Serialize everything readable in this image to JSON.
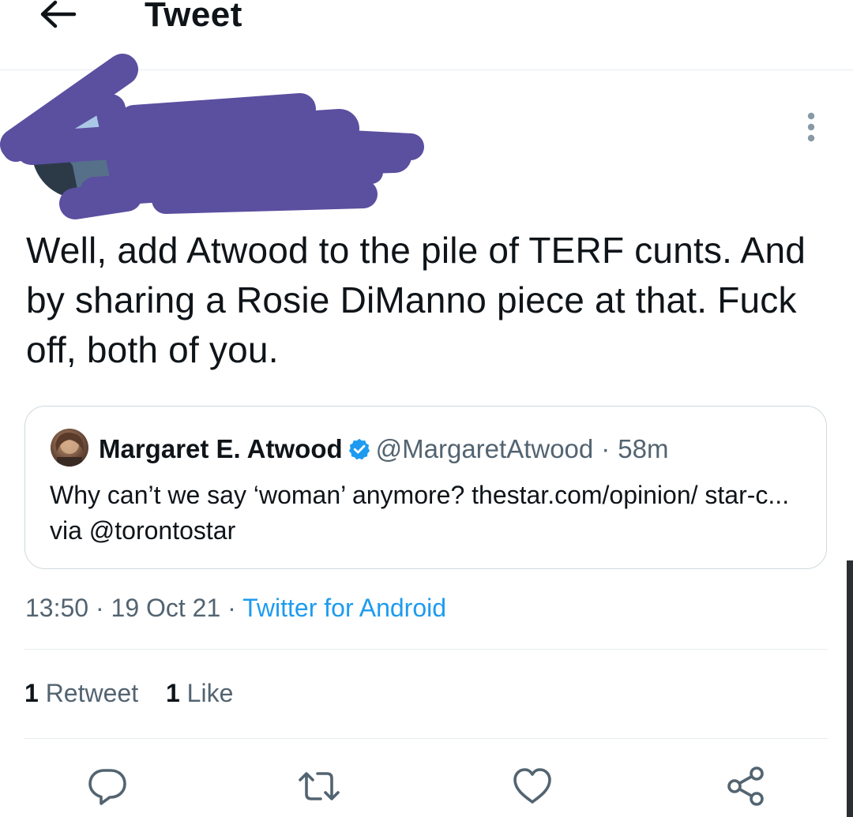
{
  "header": {
    "title": "Tweet"
  },
  "icons": {
    "back": "arrow-left-icon",
    "more": "more-vertical-icon",
    "verified": "verified-badge-icon",
    "reply": "reply-icon",
    "retweet": "retweet-icon",
    "like": "heart-icon",
    "share": "share-icon"
  },
  "colors": {
    "accent": "#1d9bf0",
    "redaction": "#5b4fa0",
    "secondary_text": "#536471"
  },
  "tweet": {
    "text": "Well, add Atwood to the pile of TERF cunts. And by sharing a Rosie DiManno piece at that. Fuck off, both of you."
  },
  "quoted": {
    "name": "Margaret E. Atwood",
    "handle": "@MargaretAtwood",
    "separator": "·",
    "time": "58m",
    "text": "Why can’t we say ‘woman’ anymore? thestar.com/opinion/ star-c... via @torontostar"
  },
  "meta": {
    "time": "13:50",
    "separator": "·",
    "date": "19 Oct 21",
    "source": "Twitter for Android"
  },
  "stats": {
    "retweet_count": "1",
    "retweet_label": "Retweet",
    "like_count": "1",
    "like_label": "Like"
  }
}
